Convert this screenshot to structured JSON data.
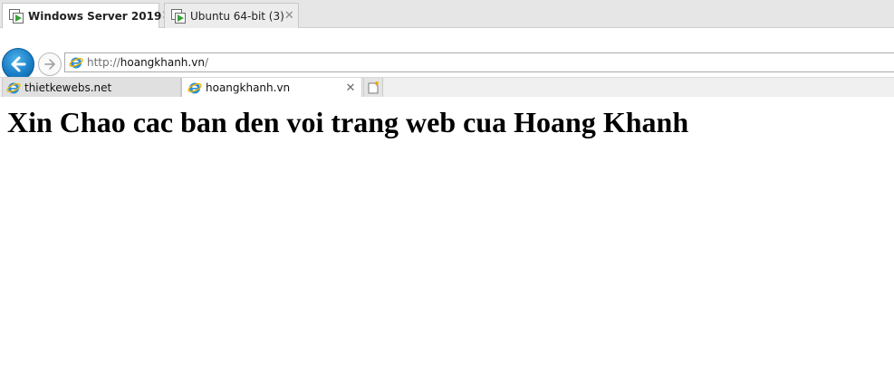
{
  "vm_tabs": [
    {
      "label": "Windows Server 2019",
      "close": "✕",
      "active": true
    },
    {
      "label": "Ubuntu 64-bit (3)",
      "close": "✕",
      "active": false
    }
  ],
  "address_bar": {
    "scheme": "http://",
    "host": "hoangkhanh.vn",
    "path": "/"
  },
  "browser_tabs": [
    {
      "label": "thietkewebs.net",
      "active": false
    },
    {
      "label": "hoangkhanh.vn",
      "close": "✕",
      "active": true
    }
  ],
  "page": {
    "heading": "Xin Chao cac ban den voi trang web cua Hoang Khanh"
  },
  "colors": {
    "back_button": "#1b7fc7",
    "vm_play": "#3aa13a",
    "ie_blue": "#2a8fd8",
    "ie_ring": "#f2b600"
  },
  "icons": {
    "vm": "vm-icon",
    "back": "back-arrow-icon",
    "forward": "forward-arrow-icon",
    "browser": "ie-icon",
    "new_tab": "new-tab-icon"
  }
}
